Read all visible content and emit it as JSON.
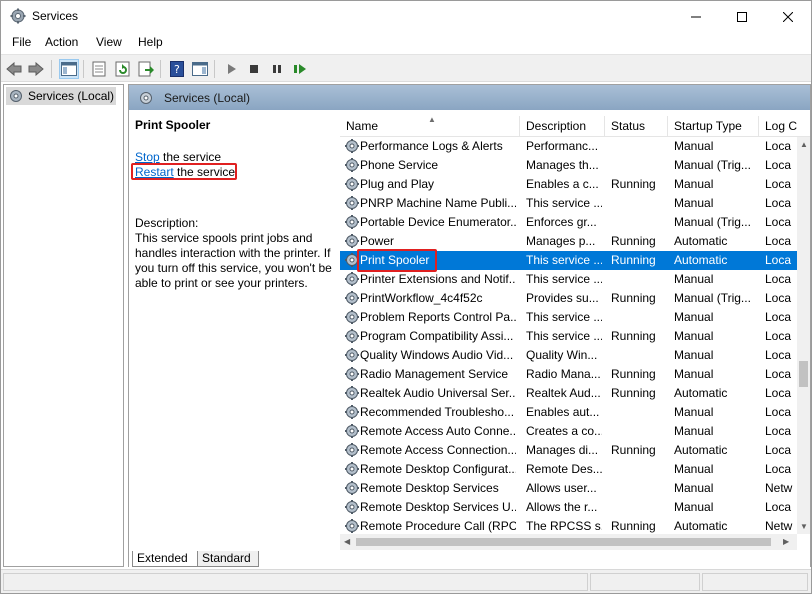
{
  "window": {
    "title": "Services"
  },
  "menu": [
    "File",
    "Action",
    "View",
    "Help"
  ],
  "tree": {
    "root_label": "Services (Local)"
  },
  "pane": {
    "header_title": "Services (Local)"
  },
  "details": {
    "service_name": "Print Spooler",
    "stop_link": "Stop",
    "stop_suffix": " the service",
    "restart_link": "Restart",
    "restart_suffix": " the service",
    "description_label": "Description:",
    "description_text": "This service spools print jobs and handles interaction with the printer. If you turn off this service, you won't be able to print or see your printers."
  },
  "columns": {
    "name": "Name",
    "description": "Description",
    "status": "Status",
    "startup_type": "Startup Type",
    "log_on_as": "Log C"
  },
  "services": [
    {
      "name": "Performance Logs & Alerts",
      "description": "Performanc...",
      "status": "",
      "startup": "Manual",
      "logon": "Loca"
    },
    {
      "name": "Phone Service",
      "description": "Manages th...",
      "status": "",
      "startup": "Manual (Trig...",
      "logon": "Loca"
    },
    {
      "name": "Plug and Play",
      "description": "Enables a c...",
      "status": "Running",
      "startup": "Manual",
      "logon": "Loca"
    },
    {
      "name": "PNRP Machine Name Publi...",
      "description": "This service ...",
      "status": "",
      "startup": "Manual",
      "logon": "Loca"
    },
    {
      "name": "Portable Device Enumerator...",
      "description": "Enforces gr...",
      "status": "",
      "startup": "Manual (Trig...",
      "logon": "Loca"
    },
    {
      "name": "Power",
      "description": "Manages p...",
      "status": "Running",
      "startup": "Automatic",
      "logon": "Loca"
    },
    {
      "name": "Print Spooler",
      "description": "This service ...",
      "status": "Running",
      "startup": "Automatic",
      "logon": "Loca",
      "selected": true
    },
    {
      "name": "Printer Extensions and Notif...",
      "description": "This service ...",
      "status": "",
      "startup": "Manual",
      "logon": "Loca"
    },
    {
      "name": "PrintWorkflow_4c4f52c",
      "description": "Provides su...",
      "status": "Running",
      "startup": "Manual (Trig...",
      "logon": "Loca"
    },
    {
      "name": "Problem Reports Control Pa...",
      "description": "This service ...",
      "status": "",
      "startup": "Manual",
      "logon": "Loca"
    },
    {
      "name": "Program Compatibility Assi...",
      "description": "This service ...",
      "status": "Running",
      "startup": "Manual",
      "logon": "Loca"
    },
    {
      "name": "Quality Windows Audio Vid...",
      "description": "Quality Win...",
      "status": "",
      "startup": "Manual",
      "logon": "Loca"
    },
    {
      "name": "Radio Management Service",
      "description": "Radio Mana...",
      "status": "Running",
      "startup": "Manual",
      "logon": "Loca"
    },
    {
      "name": "Realtek Audio Universal Ser...",
      "description": "Realtek Aud...",
      "status": "Running",
      "startup": "Automatic",
      "logon": "Loca"
    },
    {
      "name": "Recommended Troublesho...",
      "description": "Enables aut...",
      "status": "",
      "startup": "Manual",
      "logon": "Loca"
    },
    {
      "name": "Remote Access Auto Conne...",
      "description": "Creates a co...",
      "status": "",
      "startup": "Manual",
      "logon": "Loca"
    },
    {
      "name": "Remote Access Connection...",
      "description": "Manages di...",
      "status": "Running",
      "startup": "Automatic",
      "logon": "Loca"
    },
    {
      "name": "Remote Desktop Configurat...",
      "description": "Remote Des...",
      "status": "",
      "startup": "Manual",
      "logon": "Loca"
    },
    {
      "name": "Remote Desktop Services",
      "description": "Allows user...",
      "status": "",
      "startup": "Manual",
      "logon": "Netw"
    },
    {
      "name": "Remote Desktop Services U...",
      "description": "Allows the r...",
      "status": "",
      "startup": "Manual",
      "logon": "Loca"
    },
    {
      "name": "Remote Procedure Call (RPC)",
      "description": "The RPCSS s...",
      "status": "Running",
      "startup": "Automatic",
      "logon": "Netw"
    }
  ],
  "tabs": {
    "extended": "Extended",
    "standard": "Standard"
  },
  "colors": {
    "selection": "#0078d7",
    "link": "#0066cc",
    "highlight_box": "#e02020",
    "header_band": "#9bb3cc"
  }
}
